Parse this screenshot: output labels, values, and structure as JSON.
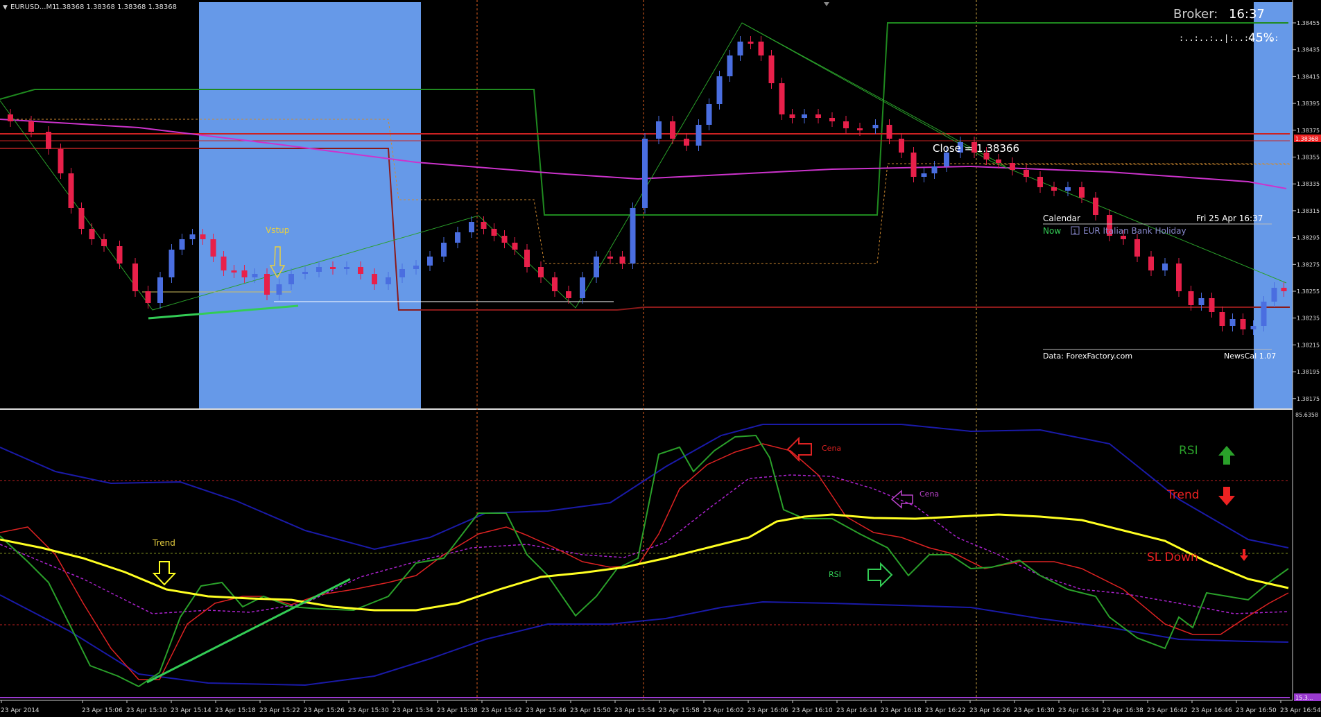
{
  "window": {
    "title": "EURUSD...M1",
    "ohlc": "1.38368 1.38368 1.38368 1.38368"
  },
  "broker": {
    "label": "Broker:",
    "time": "16:37",
    "progress_text": ":..:..:..|:..:..:..:",
    "progress_pct": "45%",
    "progress_value": 45
  },
  "colors": {
    "bull": "#4a6ee0",
    "bear": "#e8204a",
    "session_fill": "#6699e8",
    "ma_magenta": "#cc33cc",
    "channel_green": "#1f8a1f",
    "support_red": "#8b1a1a",
    "rsi_green": "#2aa02a",
    "trend_yellow": "#ffff22",
    "band_blue": "#1a1aa8"
  },
  "price_axis": {
    "labels": [
      "1.38455",
      "1.38435",
      "1.38415",
      "1.38395",
      "1.38375",
      "1.38355",
      "1.38335",
      "1.38315",
      "1.38295",
      "1.38275",
      "1.38255",
      "1.38235",
      "1.38215",
      "1.38195",
      "1.38175"
    ],
    "current": "1.38368"
  },
  "indicator_axis": {
    "top": "85.6358",
    "bottom": "15.3..."
  },
  "time_axis": {
    "labels": [
      "23 Apr 2014",
      "23 Apr 15:06",
      "23 Apr 15:10",
      "23 Apr 15:14",
      "23 Apr 15:18",
      "23 Apr 15:22",
      "23 Apr 15:26",
      "23 Apr 15:30",
      "23 Apr 15:34",
      "23 Apr 15:38",
      "23 Apr 15:42",
      "23 Apr 15:46",
      "23 Apr 15:50",
      "23 Apr 15:54",
      "23 Apr 15:58",
      "23 Apr 16:02",
      "23 Apr 16:06",
      "23 Apr 16:10",
      "23 Apr 16:14",
      "23 Apr 16:18",
      "23 Apr 16:22",
      "23 Apr 16:26",
      "23 Apr 16:30",
      "23 Apr 16:34",
      "23 Apr 16:38",
      "23 Apr 16:42",
      "23 Apr 16:46",
      "23 Apr 16:50",
      "23 Apr 16:54",
      "23 Apr 16:5"
    ]
  },
  "annotations": {
    "close_label": "Close = 1.38366",
    "vstup": "Vstup",
    "trend": "Trend",
    "rsi_sub": "RSI",
    "cena_red": "Cena",
    "cena_violet": "Cena"
  },
  "calendar": {
    "title": "Calendar",
    "date": "Fri 25 Apr 16:37",
    "now": "Now",
    "event_icon": "1",
    "event": "EUR Italian Bank Holiday",
    "source": "Data: ForexFactory.com",
    "version": "NewsCal 1.07"
  },
  "legend": {
    "rsi": "RSI",
    "trend": "Trend",
    "sl_down": "SL Down"
  }
}
